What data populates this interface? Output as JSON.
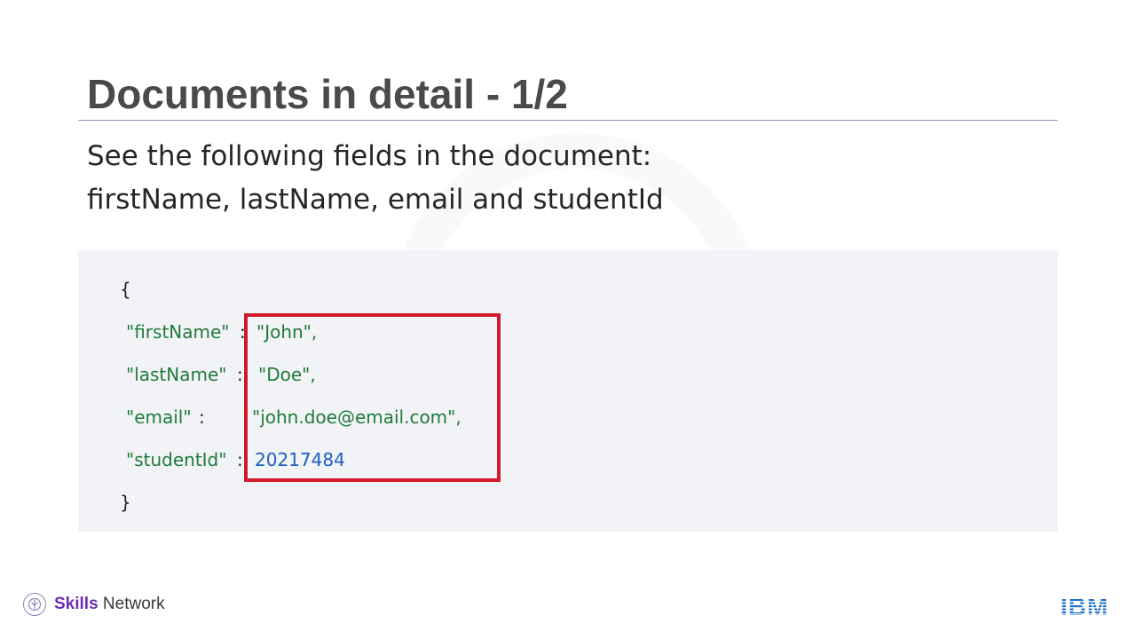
{
  "slide": {
    "title": "Documents in detail - 1/2",
    "subtitle_line1": "See the following fields in the document:",
    "subtitle_line2": "firstName, lastName, email and studentId"
  },
  "code": {
    "open_brace": "{",
    "close_brace": "}",
    "rows": [
      {
        "key": "\"firstName\"",
        "colon": ":",
        "value": "\"John\",",
        "value_type": "string"
      },
      {
        "key": "\"lastName\"",
        "colon": ":",
        "value": "\"Doe\",",
        "value_type": "string"
      },
      {
        "key": "\"email\"",
        "colon": ":",
        "value": "\"john.doe@email.com\",",
        "value_type": "string"
      },
      {
        "key": "\"studentId\"",
        "colon": ":",
        "value": "20217484",
        "value_type": "number"
      }
    ]
  },
  "footer": {
    "brand_bold": "Skills",
    "brand_rest": " Network",
    "logo_text": "IBM"
  },
  "colors": {
    "title": "#4a4a4a",
    "key_green": "#1f7a3a",
    "number_blue": "#1f5fc4",
    "highlight_red": "#d11a2a",
    "panel_bg": "#f2f3f6",
    "brand_purple": "#6d2fb6",
    "ibm_blue": "#1f70c1"
  }
}
